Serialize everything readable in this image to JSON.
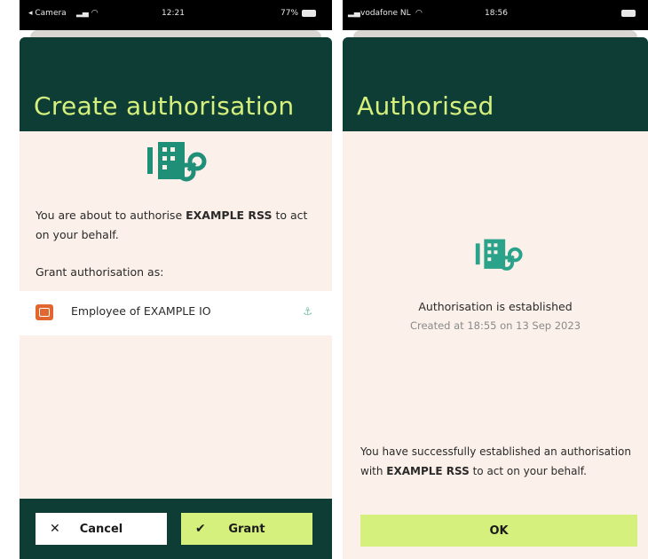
{
  "left": {
    "status": {
      "carrier": "◂ Camera",
      "time": "12:21",
      "battery": "77%"
    },
    "header_title": "Create authorisation",
    "intro_prefix": "You are about to authorise ",
    "intro_org": "EXAMPLE RSS",
    "intro_suffix": " to act on your behalf.",
    "grant_as_label": "Grant authorisation as:",
    "option_label": "Employee of EXAMPLE IO",
    "cancel_label": "Cancel",
    "grant_label": "Grant",
    "icons": [
      "building-link-icon",
      "id-card-icon",
      "chevron-icon",
      "close-icon",
      "check-icon"
    ]
  },
  "right": {
    "status": {
      "carrier": "vodafone NL",
      "time": "18:56",
      "battery": ""
    },
    "header_title": "Authorised",
    "established": "Authorisation is established",
    "created": "Created at 18:55 on 13 Sep 2023",
    "success_prefix": "You have successfully established an authorisation with ",
    "success_org": "EXAMPLE RSS",
    "success_suffix": " to act on your behalf.",
    "ok_label": "OK"
  },
  "colors": {
    "header": "#0e3d35",
    "accent": "#d6f07d",
    "body": "#fbf0ea",
    "card": "#e2662f",
    "icon": "#1f8f78"
  }
}
